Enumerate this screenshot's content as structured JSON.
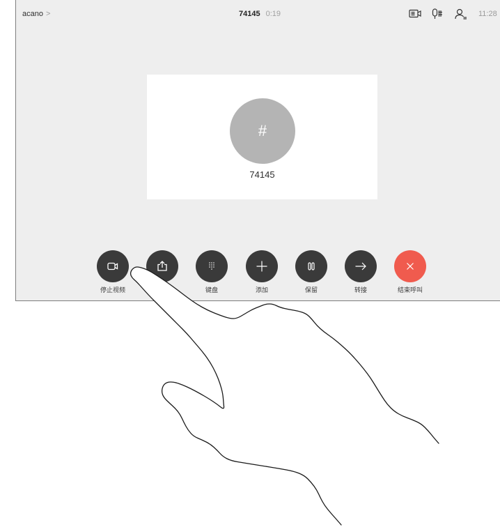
{
  "topbar": {
    "site_name": "acano",
    "site_chevron": ">",
    "call_number": "74145",
    "call_duration": "0:19",
    "time": "11:28",
    "icons": [
      "self-view-icon",
      "microphone-icon",
      "person-icon"
    ]
  },
  "participant": {
    "avatar_symbol": "#",
    "number": "74145"
  },
  "controls": [
    {
      "label": "停止视频",
      "icon": "camera-icon",
      "color": "#3a3a3a"
    },
    {
      "icon": "share-icon",
      "color": "#3a3a3a"
    },
    {
      "label": "键盘",
      "icon": "keypad-icon",
      "color": "#3a3a3a"
    },
    {
      "label": "添加",
      "icon": "plus-icon",
      "color": "#3a3a3a"
    },
    {
      "label": "保留",
      "icon": "pause-icon",
      "color": "#3a3a3a"
    },
    {
      "label": "转接",
      "icon": "arrow-right-icon",
      "color": "#3a3a3a"
    },
    {
      "label": "结束呼叫",
      "icon": "close-icon",
      "color": "#f05b4e"
    }
  ],
  "colors": {
    "screen_background": "#eeeeee",
    "card_background": "#ffffff",
    "avatar": "#b4b4b4"
  }
}
